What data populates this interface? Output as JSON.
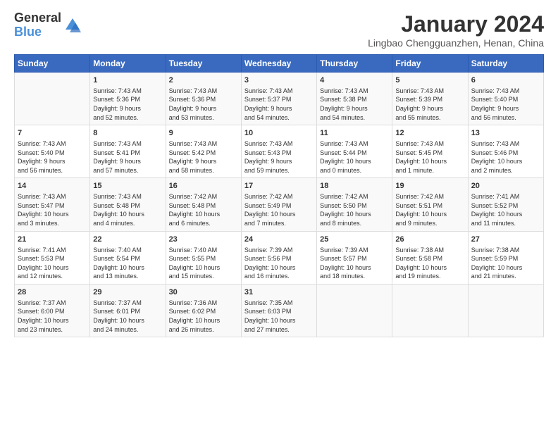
{
  "logo": {
    "general": "General",
    "blue": "Blue"
  },
  "title": "January 2024",
  "subtitle": "Lingbao Chengguanzhen, Henan, China",
  "days_header": [
    "Sunday",
    "Monday",
    "Tuesday",
    "Wednesday",
    "Thursday",
    "Friday",
    "Saturday"
  ],
  "weeks": [
    [
      {
        "day": "",
        "lines": []
      },
      {
        "day": "1",
        "lines": [
          "Sunrise: 7:43 AM",
          "Sunset: 5:36 PM",
          "Daylight: 9 hours",
          "and 52 minutes."
        ]
      },
      {
        "day": "2",
        "lines": [
          "Sunrise: 7:43 AM",
          "Sunset: 5:36 PM",
          "Daylight: 9 hours",
          "and 53 minutes."
        ]
      },
      {
        "day": "3",
        "lines": [
          "Sunrise: 7:43 AM",
          "Sunset: 5:37 PM",
          "Daylight: 9 hours",
          "and 54 minutes."
        ]
      },
      {
        "day": "4",
        "lines": [
          "Sunrise: 7:43 AM",
          "Sunset: 5:38 PM",
          "Daylight: 9 hours",
          "and 54 minutes."
        ]
      },
      {
        "day": "5",
        "lines": [
          "Sunrise: 7:43 AM",
          "Sunset: 5:39 PM",
          "Daylight: 9 hours",
          "and 55 minutes."
        ]
      },
      {
        "day": "6",
        "lines": [
          "Sunrise: 7:43 AM",
          "Sunset: 5:40 PM",
          "Daylight: 9 hours",
          "and 56 minutes."
        ]
      }
    ],
    [
      {
        "day": "7",
        "lines": [
          "Sunrise: 7:43 AM",
          "Sunset: 5:40 PM",
          "Daylight: 9 hours",
          "and 56 minutes."
        ]
      },
      {
        "day": "8",
        "lines": [
          "Sunrise: 7:43 AM",
          "Sunset: 5:41 PM",
          "Daylight: 9 hours",
          "and 57 minutes."
        ]
      },
      {
        "day": "9",
        "lines": [
          "Sunrise: 7:43 AM",
          "Sunset: 5:42 PM",
          "Daylight: 9 hours",
          "and 58 minutes."
        ]
      },
      {
        "day": "10",
        "lines": [
          "Sunrise: 7:43 AM",
          "Sunset: 5:43 PM",
          "Daylight: 9 hours",
          "and 59 minutes."
        ]
      },
      {
        "day": "11",
        "lines": [
          "Sunrise: 7:43 AM",
          "Sunset: 5:44 PM",
          "Daylight: 10 hours",
          "and 0 minutes."
        ]
      },
      {
        "day": "12",
        "lines": [
          "Sunrise: 7:43 AM",
          "Sunset: 5:45 PM",
          "Daylight: 10 hours",
          "and 1 minute."
        ]
      },
      {
        "day": "13",
        "lines": [
          "Sunrise: 7:43 AM",
          "Sunset: 5:46 PM",
          "Daylight: 10 hours",
          "and 2 minutes."
        ]
      }
    ],
    [
      {
        "day": "14",
        "lines": [
          "Sunrise: 7:43 AM",
          "Sunset: 5:47 PM",
          "Daylight: 10 hours",
          "and 3 minutes."
        ]
      },
      {
        "day": "15",
        "lines": [
          "Sunrise: 7:43 AM",
          "Sunset: 5:48 PM",
          "Daylight: 10 hours",
          "and 4 minutes."
        ]
      },
      {
        "day": "16",
        "lines": [
          "Sunrise: 7:42 AM",
          "Sunset: 5:48 PM",
          "Daylight: 10 hours",
          "and 6 minutes."
        ]
      },
      {
        "day": "17",
        "lines": [
          "Sunrise: 7:42 AM",
          "Sunset: 5:49 PM",
          "Daylight: 10 hours",
          "and 7 minutes."
        ]
      },
      {
        "day": "18",
        "lines": [
          "Sunrise: 7:42 AM",
          "Sunset: 5:50 PM",
          "Daylight: 10 hours",
          "and 8 minutes."
        ]
      },
      {
        "day": "19",
        "lines": [
          "Sunrise: 7:42 AM",
          "Sunset: 5:51 PM",
          "Daylight: 10 hours",
          "and 9 minutes."
        ]
      },
      {
        "day": "20",
        "lines": [
          "Sunrise: 7:41 AM",
          "Sunset: 5:52 PM",
          "Daylight: 10 hours",
          "and 11 minutes."
        ]
      }
    ],
    [
      {
        "day": "21",
        "lines": [
          "Sunrise: 7:41 AM",
          "Sunset: 5:53 PM",
          "Daylight: 10 hours",
          "and 12 minutes."
        ]
      },
      {
        "day": "22",
        "lines": [
          "Sunrise: 7:40 AM",
          "Sunset: 5:54 PM",
          "Daylight: 10 hours",
          "and 13 minutes."
        ]
      },
      {
        "day": "23",
        "lines": [
          "Sunrise: 7:40 AM",
          "Sunset: 5:55 PM",
          "Daylight: 10 hours",
          "and 15 minutes."
        ]
      },
      {
        "day": "24",
        "lines": [
          "Sunrise: 7:39 AM",
          "Sunset: 5:56 PM",
          "Daylight: 10 hours",
          "and 16 minutes."
        ]
      },
      {
        "day": "25",
        "lines": [
          "Sunrise: 7:39 AM",
          "Sunset: 5:57 PM",
          "Daylight: 10 hours",
          "and 18 minutes."
        ]
      },
      {
        "day": "26",
        "lines": [
          "Sunrise: 7:38 AM",
          "Sunset: 5:58 PM",
          "Daylight: 10 hours",
          "and 19 minutes."
        ]
      },
      {
        "day": "27",
        "lines": [
          "Sunrise: 7:38 AM",
          "Sunset: 5:59 PM",
          "Daylight: 10 hours",
          "and 21 minutes."
        ]
      }
    ],
    [
      {
        "day": "28",
        "lines": [
          "Sunrise: 7:37 AM",
          "Sunset: 6:00 PM",
          "Daylight: 10 hours",
          "and 23 minutes."
        ]
      },
      {
        "day": "29",
        "lines": [
          "Sunrise: 7:37 AM",
          "Sunset: 6:01 PM",
          "Daylight: 10 hours",
          "and 24 minutes."
        ]
      },
      {
        "day": "30",
        "lines": [
          "Sunrise: 7:36 AM",
          "Sunset: 6:02 PM",
          "Daylight: 10 hours",
          "and 26 minutes."
        ]
      },
      {
        "day": "31",
        "lines": [
          "Sunrise: 7:35 AM",
          "Sunset: 6:03 PM",
          "Daylight: 10 hours",
          "and 27 minutes."
        ]
      },
      {
        "day": "",
        "lines": []
      },
      {
        "day": "",
        "lines": []
      },
      {
        "day": "",
        "lines": []
      }
    ]
  ]
}
